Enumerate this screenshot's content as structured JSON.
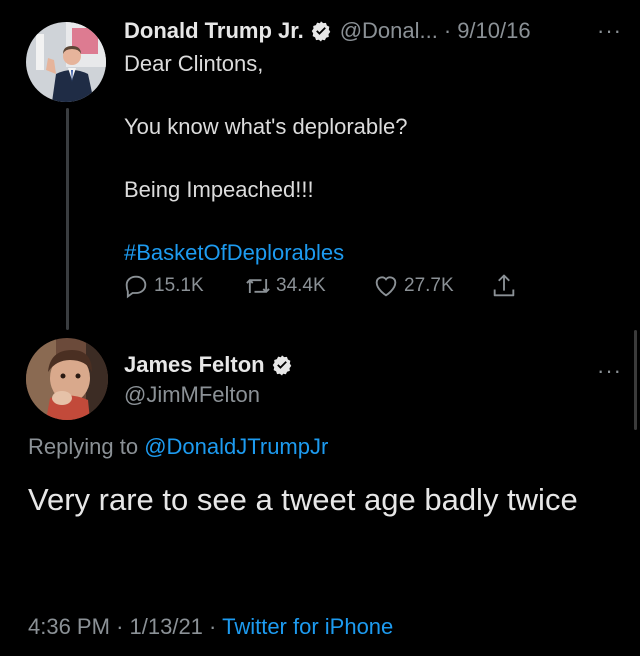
{
  "parent_tweet": {
    "author_name": "Donald Trump Jr.",
    "handle": "@Donal...",
    "separator": "·",
    "date": "9/10/16",
    "more": "···",
    "lines": [
      "Dear Clintons,",
      "You know what's deplorable?",
      "Being Impeached!!!"
    ],
    "hashtag": "#BasketOfDeplorables",
    "stats": {
      "replies": "15.1K",
      "retweets": "34.4K",
      "likes": "27.7K"
    }
  },
  "main_tweet": {
    "author_name": "James Felton",
    "handle": "@JimMFelton",
    "more": "···",
    "replying_prefix": "Replying to",
    "replying_to": "@DonaldJTrumpJr",
    "text": "Very rare to see a tweet age badly twice",
    "time": "4:36 PM",
    "date": "1/13/21",
    "separator": "·",
    "source": "Twitter for iPhone"
  },
  "colors": {
    "background": "#000000",
    "link": "#1d9bf0",
    "muted": "#8b9196",
    "text": "#e7e7e7"
  },
  "icons": [
    "verified-badge-icon",
    "reply-icon",
    "retweet-icon",
    "like-icon",
    "share-icon",
    "more-icon"
  ]
}
